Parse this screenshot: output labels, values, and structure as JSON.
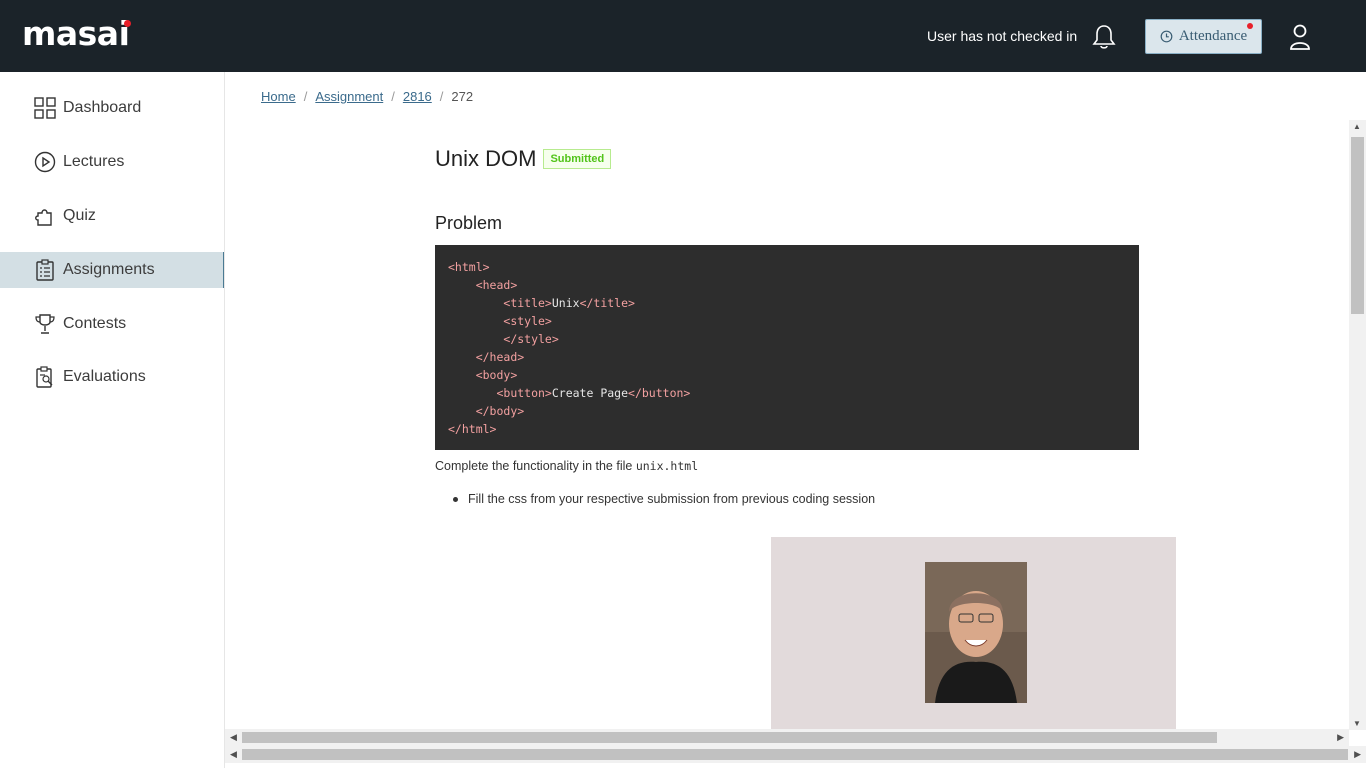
{
  "header": {
    "logo": "masai",
    "checkin_status": "User has not checked in",
    "attendance_label": "Attendance"
  },
  "sidebar": {
    "items": [
      {
        "label": "Dashboard",
        "icon": "grid-icon"
      },
      {
        "label": "Lectures",
        "icon": "play-circle-icon"
      },
      {
        "label": "Quiz",
        "icon": "puzzle-icon"
      },
      {
        "label": "Assignments",
        "icon": "clipboard-icon",
        "active": true
      },
      {
        "label": "Contests",
        "icon": "trophy-icon"
      },
      {
        "label": "Evaluations",
        "icon": "evaluation-icon"
      }
    ]
  },
  "breadcrumb": {
    "home": "Home",
    "assignment": "Assignment",
    "id1": "2816",
    "id2": "272"
  },
  "page": {
    "title": "Unix DOM",
    "status": "Submitted",
    "problem_heading": "Problem",
    "desc_prefix": "Complete the functionality in the file ",
    "desc_file": "unix.html",
    "bullet": "Fill the css from your respective submission from previous coding session",
    "code_lines": [
      "<html>",
      "    <head>",
      "        <title>Unix</title>",
      "        <style>",
      "        </style>",
      "    </head>",
      "    <body>",
      "       <button>Create Page</button>",
      "    </body>",
      "</html>"
    ]
  },
  "colors": {
    "header_bg": "#1b2329",
    "accent_red": "#e8202a",
    "active_nav_bg": "#d3dfe4",
    "badge_green": "#52c41a"
  }
}
